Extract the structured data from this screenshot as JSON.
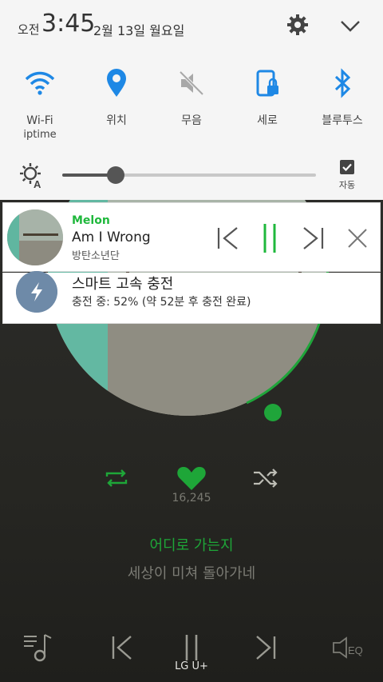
{
  "status_bar": {
    "ampm": "오전",
    "time": "3:45",
    "date": "2월 13일 월요일",
    "settings_icon": "gear-icon",
    "expand_icon": "chevron-down-icon"
  },
  "quick_settings": [
    {
      "label": "Wi-Fi",
      "sub": "iptime",
      "icon": "wifi-icon",
      "color": "#1e88e5",
      "active": true
    },
    {
      "label": "위치",
      "sub": "",
      "icon": "location-icon",
      "color": "#1e88e5",
      "active": true
    },
    {
      "label": "무음",
      "sub": "",
      "icon": "mute-icon",
      "color": "#9e9e9e",
      "active": false
    },
    {
      "label": "세로",
      "sub": "",
      "icon": "rotation-lock-icon",
      "color": "#1e88e5",
      "active": true
    },
    {
      "label": "블루투스",
      "sub": "",
      "icon": "bluetooth-icon",
      "color": "#1e88e5",
      "active": true
    }
  ],
  "brightness": {
    "level": 0.21,
    "auto_label": "자동",
    "auto_checked": true
  },
  "music_notification": {
    "app": "Melon",
    "song": "Am I Wrong",
    "artist": "방탄소년단",
    "accent": "#1fb83c"
  },
  "charge_notification": {
    "title": "스마트 고속 충전",
    "detail": "충전 중: 52% (약 52분 후 충전 완료)"
  },
  "player": {
    "like_count": "16,245",
    "lyric_current": "어디로 가는지",
    "lyric_next": "세상이 미쳐 돌아가네",
    "accent": "#1ea638"
  },
  "carrier": "LG U+"
}
